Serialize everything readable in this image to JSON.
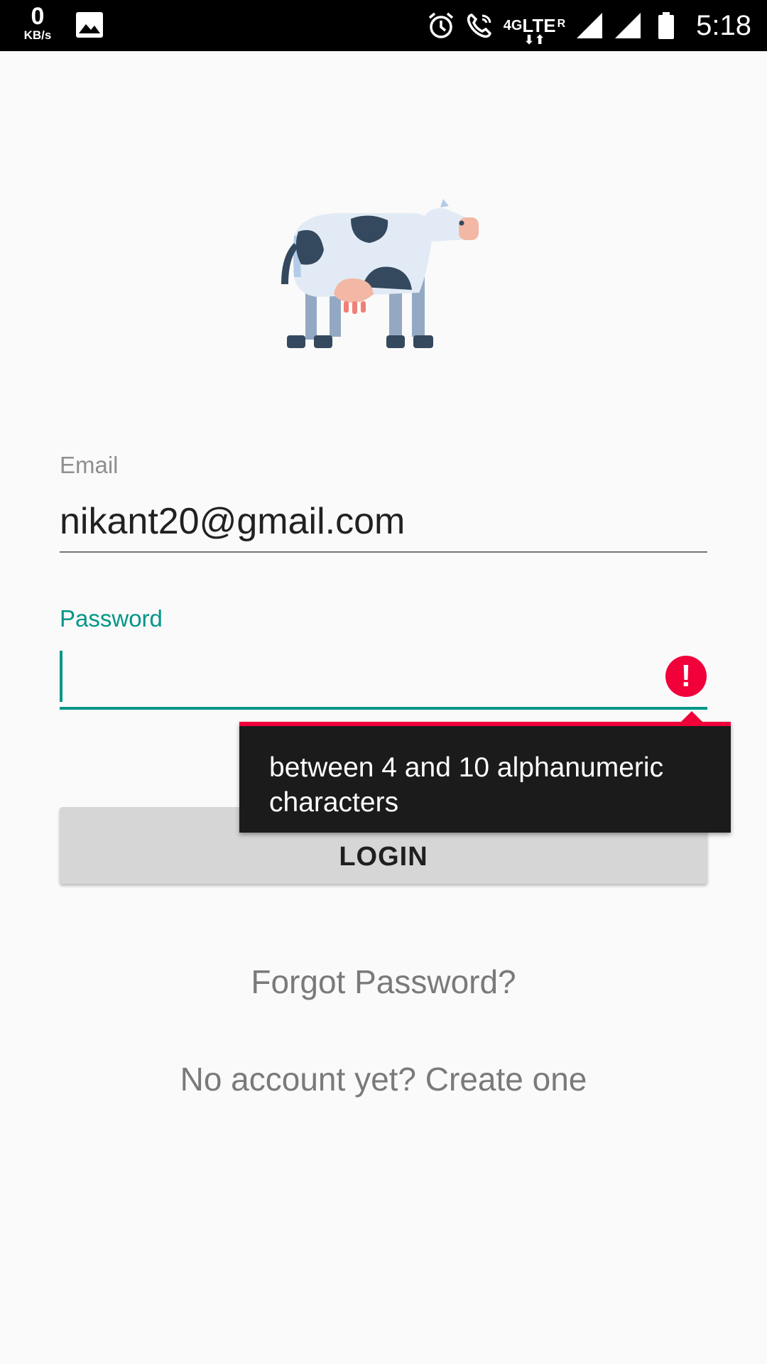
{
  "status_bar": {
    "speed_value": "0",
    "speed_unit": "KB/s",
    "network_4g": "4G",
    "network_lte": "LTE",
    "network_roaming": "R",
    "time": "5:18",
    "icons": [
      "gallery-icon",
      "alarm-icon",
      "wifi-calling-icon",
      "signal-icon",
      "battery-icon"
    ]
  },
  "logo": {
    "icon": "cow-icon"
  },
  "form": {
    "email_label": "Email",
    "email_value": "nikant20@gmail.com",
    "password_label": "Password",
    "password_value": "",
    "error_message": "between 4 and 10 alphanumeric characters",
    "login_label": "LOGIN"
  },
  "links": {
    "forgot_password": "Forgot Password?",
    "create_account": "No account yet? Create one"
  },
  "colors": {
    "accent": "#009688",
    "error": "#f1003a",
    "background": "#fafafa",
    "button": "#d6d6d6"
  }
}
